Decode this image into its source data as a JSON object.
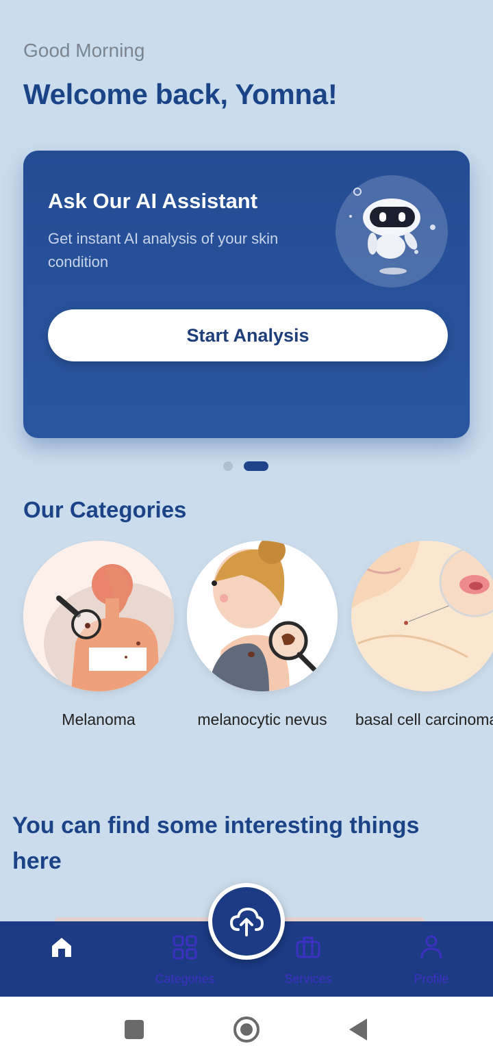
{
  "header": {
    "greeting": "Good Morning",
    "welcome": "Welcome back, Yomna!"
  },
  "ai_card": {
    "title": "Ask Our AI Assistant",
    "description": "Get instant AI analysis of your skin condition",
    "button_label": "Start Analysis",
    "icon": "robot-icon"
  },
  "carousel": {
    "page_count": 2,
    "active_index": 1
  },
  "categories": {
    "title": "Our Categories",
    "items": [
      {
        "label": "Melanoma",
        "image": "melanoma-illustration"
      },
      {
        "label": "melanocytic nevus",
        "image": "nevus-illustration"
      },
      {
        "label": "basal cell carcinoma",
        "image": "basal-cell-illustration"
      }
    ]
  },
  "interesting": {
    "title": "You can find some interesting things here"
  },
  "bottom_nav": {
    "items": [
      {
        "label": "",
        "icon": "home-icon",
        "active": true
      },
      {
        "label": "Categories",
        "icon": "grid-icon"
      },
      {
        "label": "Services",
        "icon": "briefcase-icon"
      },
      {
        "label": "Profile",
        "icon": "user-icon"
      }
    ],
    "fab_icon": "cloud-upload-icon"
  },
  "system_nav": {
    "icons": [
      "recents-icon",
      "home-circle-icon",
      "back-icon"
    ]
  },
  "colors": {
    "background": "#cbdcec",
    "primary": "#1c3b84",
    "card": "#244c93",
    "title_text": "#1c4388"
  }
}
